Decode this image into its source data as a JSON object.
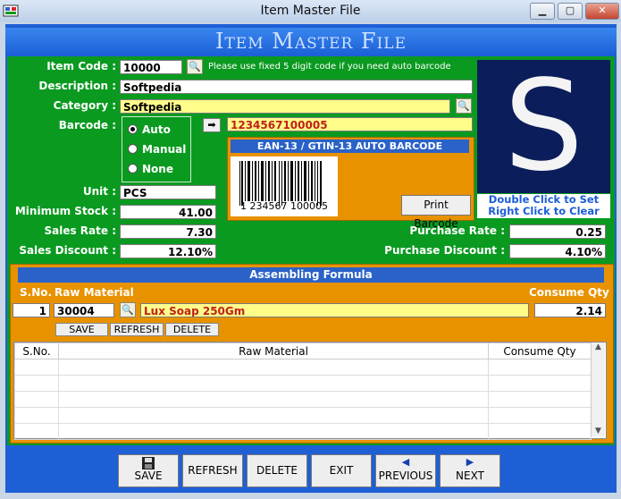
{
  "window": {
    "title": "Item Master File"
  },
  "header": {
    "title": "Item Master File"
  },
  "form": {
    "item_code_label": "Item Code :",
    "item_code_value": "10000",
    "item_code_hint": "Please use fixed 5 digit code if you need auto barcode",
    "description_label": "Description :",
    "description_value": "Softpedia",
    "category_label": "Category :",
    "category_value": "Softpedia",
    "barcode_label": "Barcode :",
    "barcode_value": "1234567100005",
    "barcode_options": [
      "Auto",
      "Manual",
      "None"
    ],
    "barcode_selected": "Auto",
    "barcode_panel_title": "EAN-13 / GTIN-13 AUTO BARCODE",
    "barcode_digits": "1 234567 100005",
    "print_barcode_label": "Print Barcode",
    "unit_label": "Unit :",
    "unit_value": "PCS",
    "min_stock_label": "Minimum Stock :",
    "min_stock_value": "41.00",
    "sales_rate_label": "Sales Rate :",
    "sales_rate_value": "7.30",
    "sales_discount_label": "Sales Discount :",
    "sales_discount_value": "12.10%",
    "purchase_rate_label": "Purchase Rate :",
    "purchase_rate_value": "0.25",
    "purchase_discount_label": "Purchase Discount :",
    "purchase_discount_value": "4.10%",
    "photo_letter": "S",
    "photo_caption_1": "Double Click to Set",
    "photo_caption_2": "Right Click to Clear"
  },
  "assembling": {
    "title": "Assembling Formula",
    "col_sno": "S.No.",
    "col_raw": "Raw Material",
    "col_qty": "Consume Qty",
    "entry_sno": "1",
    "entry_code": "30004",
    "entry_name": "Lux Soap 250Gm",
    "entry_qty": "2.14",
    "buttons": {
      "save": "SAVE",
      "refresh": "REFRESH",
      "delete": "DELETE"
    },
    "grid_headers": [
      "S.No.",
      "Raw Material",
      "Consume Qty"
    ]
  },
  "toolbar": {
    "save": "SAVE",
    "refresh": "REFRESH",
    "delete": "DELETE",
    "exit": "EXIT",
    "previous": "PREVIOUS",
    "next": "NEXT"
  },
  "icons": {
    "search": "search-icon",
    "arrow": "arrow-right-icon",
    "save": "floppy-disk-icon",
    "previous": "triangle-left-icon",
    "next": "triangle-right-icon"
  },
  "colors": {
    "frame_blue": "#1f5fd6",
    "form_green": "#0a9a20",
    "panel_orange": "#e89200",
    "field_yellow": "#fffc8a"
  }
}
